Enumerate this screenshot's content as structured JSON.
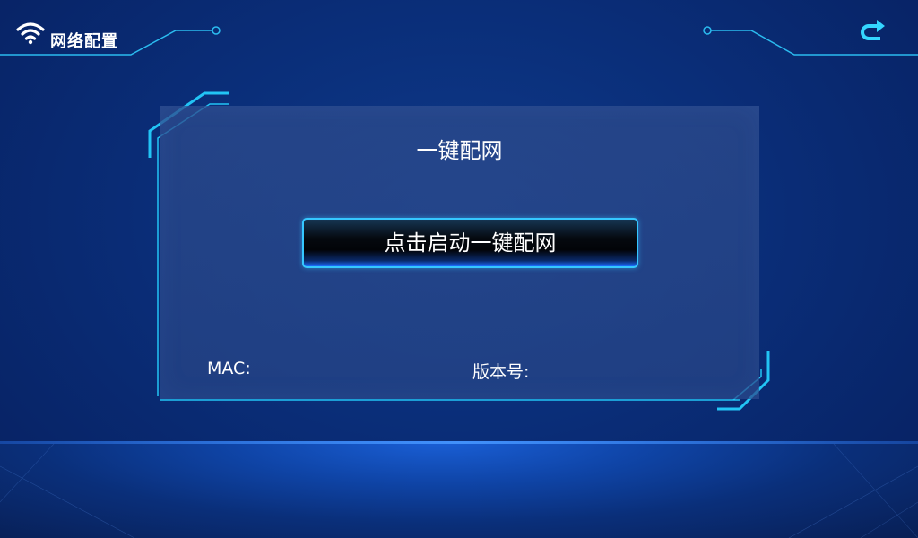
{
  "header": {
    "title": "网络配置",
    "wifi_icon": "wifi-icon",
    "back_icon": "return-arrow-icon",
    "accent_color": "#34d6ff"
  },
  "card": {
    "title": "一键配网",
    "start_button_label": "点击启动一键配网",
    "mac_label": "MAC:",
    "mac_value": "",
    "version_label": "版本号:",
    "version_value": ""
  },
  "colors": {
    "background": "#0a2e79",
    "card": "#2d4b8c",
    "frame": "#22c4f5",
    "button_border": "#35c7ff"
  }
}
